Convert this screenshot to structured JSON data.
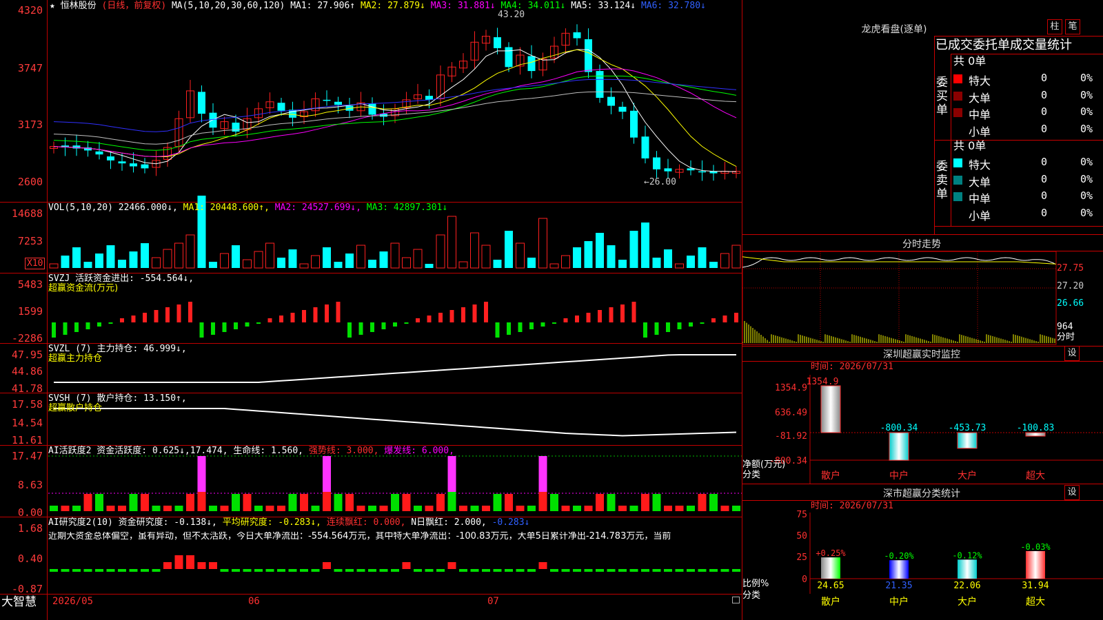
{
  "stock": {
    "star": "★",
    "name": "恒林股份",
    "mode": "(日线，前复权)"
  },
  "ma": {
    "label": "MA(5,10,20,30,60,120)",
    "ma1": "MA1: 27.906↑",
    "ma2": "MA2: 27.879↓",
    "ma3": "MA3: 31.881↓",
    "ma4": "MA4: 34.011↓",
    "ma5": "MA5: 33.124↓",
    "ma6": "MA6: 32.780↓"
  },
  "price_axis": [
    "4320",
    "3747",
    "3173",
    "2600"
  ],
  "price_marks": {
    "high": "43.20",
    "low": "←26.00"
  },
  "vol": {
    "label": "VOL(5,10,20)",
    "value": "22466.000↓,",
    "ma1": "MA1: 20448.600↑,",
    "ma2": "MA2: 24527.699↓,",
    "ma3": "MA3: 42897.301↓",
    "axis": [
      "14688",
      "7253"
    ],
    "unit": "X10"
  },
  "svzj": {
    "label": "SVZJ  活跃资金进出: -554.564↓,",
    "sub": "超赢资金流(万元)",
    "axis": [
      "5483",
      "1599",
      "-2286"
    ]
  },
  "svzl": {
    "label": "SVZL (7) 主力持仓: 46.999↓,",
    "sub": "超赢主力持仓",
    "axis": [
      "47.95",
      "44.86",
      "41.78"
    ]
  },
  "svsh": {
    "label": "SVSH (7) 散户持仓: 13.150↑,",
    "sub": "超赢散户持仓",
    "axis": [
      "17.58",
      "14.54",
      "11.61"
    ]
  },
  "ai1": {
    "label": "AI活跃度2 资金活跃度: 0.625↓,17.474,",
    "life": "生命线: 1.560,",
    "strong": "强势线: 3.000,",
    "burst": "爆发线: 6.000,",
    "axis": [
      "17.47",
      "8.63",
      "0.00"
    ]
  },
  "ai2": {
    "label": "AI研究度2(10) 资金研究度: -0.138↓,",
    "avg": "平均研究度: -0.283↓,",
    "red": "连续飘红: 0.000,",
    "nred": "N日飘红: 2.000,",
    "last": "-0.283↓",
    "axis": [
      "1.68",
      "0.40",
      "-0.87"
    ],
    "comment": "近期大资金总体偏空，虽有异动，但不太活跃，今日大单净流出：-554.564万元，其中特大单净流出：-100.83万元，大单5日累计净出-214.783万元，当前"
  },
  "bottom": {
    "brand": "大智慧",
    "dates": [
      "2026/05",
      "06",
      "07"
    ]
  },
  "lhb": {
    "title": "龙虎看盘(逐单)",
    "btn1": "柱",
    "btn2": "笔",
    "header": "已成交委托单成交量统计",
    "buy": {
      "side": "委买单",
      "total": "共 0单",
      "rows": [
        {
          "name": "特大",
          "v": "0",
          "p": "0%"
        },
        {
          "name": "大单",
          "v": "0",
          "p": "0%"
        },
        {
          "name": "中单",
          "v": "0",
          "p": "0%"
        },
        {
          "name": "小单",
          "v": "0",
          "p": "0%"
        }
      ]
    },
    "sell": {
      "side": "委卖单",
      "total": "共 0单",
      "rows": [
        {
          "name": "特大",
          "v": "0",
          "p": "0%"
        },
        {
          "name": "大单",
          "v": "0",
          "p": "0%"
        },
        {
          "name": "中单",
          "v": "0",
          "p": "0%"
        },
        {
          "name": "小单",
          "v": "0",
          "p": "0%"
        }
      ]
    }
  },
  "intraday": {
    "title": "分时走势",
    "axis": [
      "27.75",
      "27.20",
      "26.66",
      "964"
    ],
    "unit": "分时"
  },
  "monitor": {
    "title": "深圳超赢实时监控",
    "btn": "设",
    "time": "时间: 2026/07/31",
    "axis": [
      "1354.9",
      "636.49",
      "-81.92",
      "-800.34"
    ],
    "ylabel": "净额(万元)",
    "xlabel": "分类",
    "bars": [
      {
        "cat": "散户",
        "value": "1354.9"
      },
      {
        "cat": "中户",
        "value": "-800.34"
      },
      {
        "cat": "大户",
        "value": "-453.73"
      },
      {
        "cat": "超大",
        "value": "-100.83"
      }
    ]
  },
  "classify": {
    "title": "深市超赢分类统计",
    "btn": "设",
    "time": "时间: 2026/07/31",
    "axis": [
      "75",
      "50",
      "25",
      "0"
    ],
    "ylabel": "比例%",
    "xlabel": "分类",
    "bars": [
      {
        "cat": "散户",
        "top": "+0.25%",
        "value": "24.65"
      },
      {
        "cat": "中户",
        "top": "-0.20%",
        "value": "21.35"
      },
      {
        "cat": "大户",
        "top": "-0.12%",
        "value": "22.06"
      },
      {
        "cat": "超大",
        "top": "-0.03%",
        "value": "31.94"
      }
    ]
  },
  "colors": {
    "up": "#ff2020",
    "down": "#00ffff",
    "grid": "#c00000",
    "ma1": "#ffffff",
    "ma2": "#ffff00",
    "ma3": "#ff00ff",
    "ma4": "#00ff00",
    "ma5": "#c0c0c0",
    "ma6": "#3030ff"
  },
  "chart_data": {
    "type": "candlestick",
    "x_categories": [
      "2026/05",
      "06",
      "07"
    ],
    "ylim": [
      2600,
      4320
    ],
    "high": 43.2,
    "low": 26.0,
    "last_close_approx": 27.9
  }
}
